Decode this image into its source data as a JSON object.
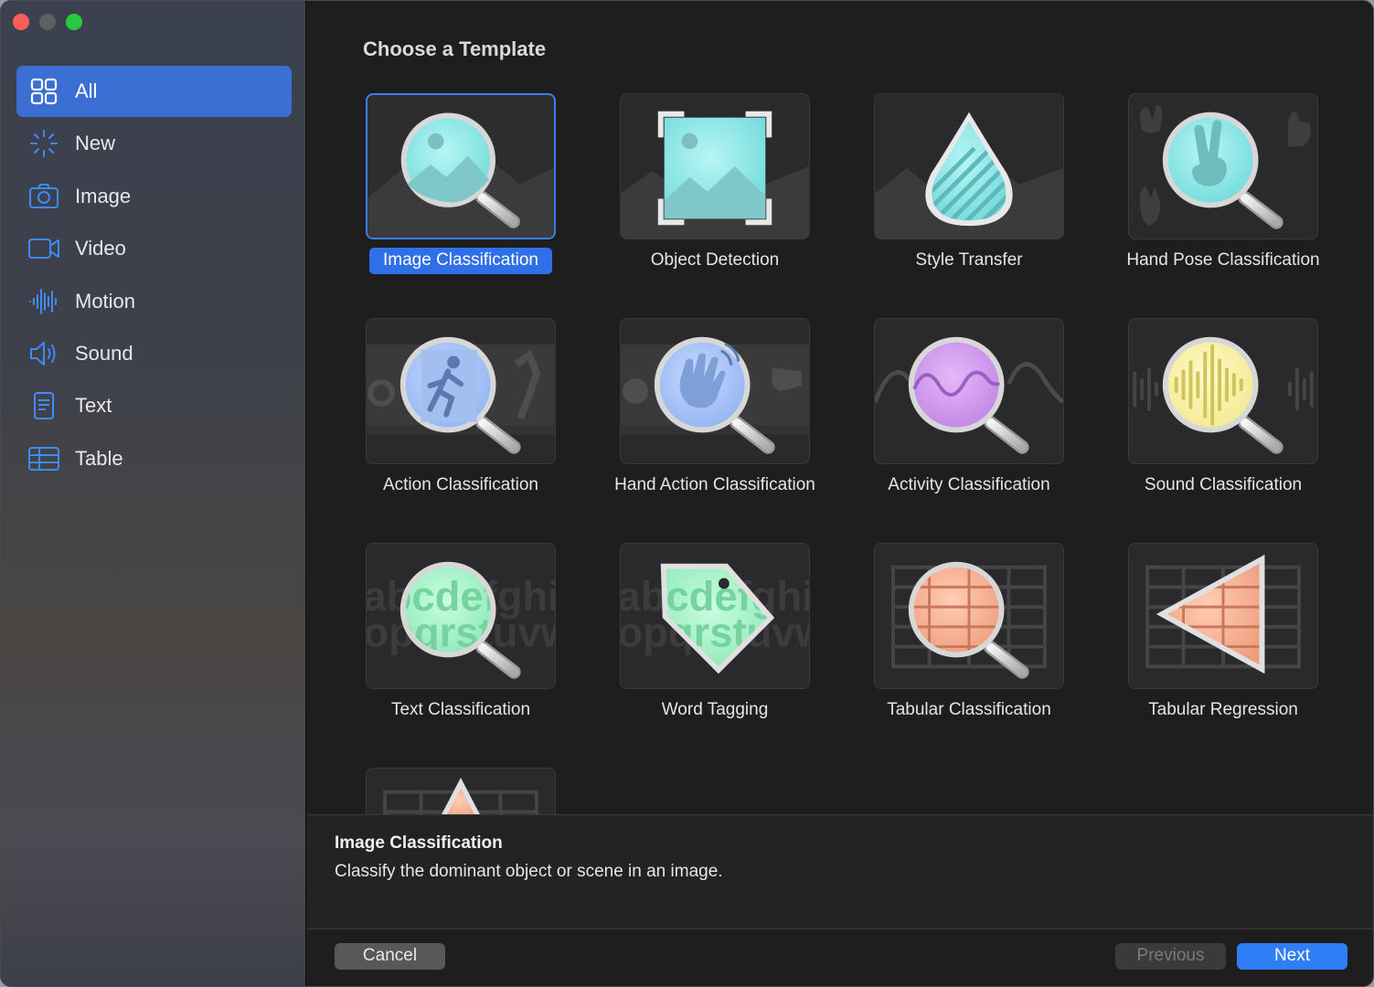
{
  "sidebar": {
    "items": [
      {
        "label": "All",
        "icon": "grid-icon"
      },
      {
        "label": "New",
        "icon": "sparkle-icon"
      },
      {
        "label": "Image",
        "icon": "camera-icon"
      },
      {
        "label": "Video",
        "icon": "video-camera-icon"
      },
      {
        "label": "Motion",
        "icon": "waveform-icon"
      },
      {
        "label": "Sound",
        "icon": "speaker-icon"
      },
      {
        "label": "Text",
        "icon": "document-icon"
      },
      {
        "label": "Table",
        "icon": "table-icon"
      }
    ],
    "selected": "All"
  },
  "main": {
    "title": "Choose a Template",
    "templates": [
      {
        "label": "Image Classification",
        "icon": "image-magnifier-icon",
        "selected": true
      },
      {
        "label": "Object Detection",
        "icon": "object-detection-icon"
      },
      {
        "label": "Style Transfer",
        "icon": "droplet-icon"
      },
      {
        "label": "Hand Pose Classification",
        "icon": "hand-pose-magnifier-icon"
      },
      {
        "label": "Action Classification",
        "icon": "running-person-magnifier-icon"
      },
      {
        "label": "Hand Action Classification",
        "icon": "waving-hand-magnifier-icon"
      },
      {
        "label": "Activity Classification",
        "icon": "sine-wave-magnifier-icon"
      },
      {
        "label": "Sound Classification",
        "icon": "audio-wave-magnifier-icon"
      },
      {
        "label": "Text Classification",
        "icon": "text-magnifier-icon"
      },
      {
        "label": "Word Tagging",
        "icon": "tag-icon"
      },
      {
        "label": "Tabular Classification",
        "icon": "table-magnifier-icon"
      },
      {
        "label": "Tabular Regression",
        "icon": "table-triangle-icon"
      },
      {
        "label": "",
        "icon": "table-triangle-partial-icon"
      }
    ],
    "text_thumb_line1": "abcdefghi",
    "text_thumb_line2": "opqrstuvw"
  },
  "description": {
    "title": "Image Classification",
    "text": "Classify the dominant object or scene in an image."
  },
  "footer": {
    "cancel_label": "Cancel",
    "previous_label": "Previous",
    "next_label": "Next"
  },
  "colors": {
    "accent": "#2f7ef6",
    "sidebar_selected": "#3b6fd4",
    "close": "#ff5f57",
    "maximize": "#28c840"
  }
}
